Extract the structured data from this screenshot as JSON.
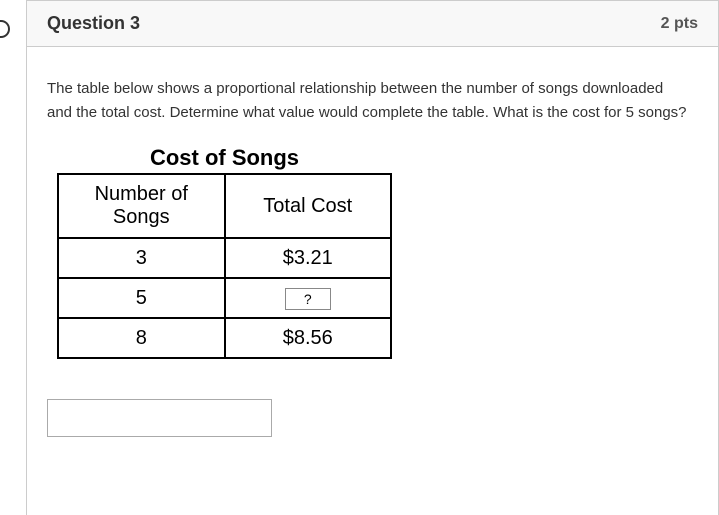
{
  "header": {
    "question_label": "Question 3",
    "points": "2 pts"
  },
  "prompt": "The table below shows a proportional relationship between the number of songs downloaded and the total cost.  Determine what value would complete the table.  What is the cost for 5 songs?",
  "table": {
    "title": "Cost of Songs",
    "col1_header": "Number of Songs",
    "col2_header": "Total Cost",
    "rows": [
      {
        "songs": "3",
        "cost": "$3.21"
      },
      {
        "songs": "5",
        "cost": "?"
      },
      {
        "songs": "8",
        "cost": "$8.56"
      }
    ]
  },
  "answer": {
    "value": ""
  },
  "chart_data": {
    "type": "table",
    "title": "Cost of Songs",
    "columns": [
      "Number of Songs",
      "Total Cost"
    ],
    "rows": [
      [
        "3",
        "$3.21"
      ],
      [
        "5",
        "?"
      ],
      [
        "8",
        "$8.56"
      ]
    ]
  }
}
